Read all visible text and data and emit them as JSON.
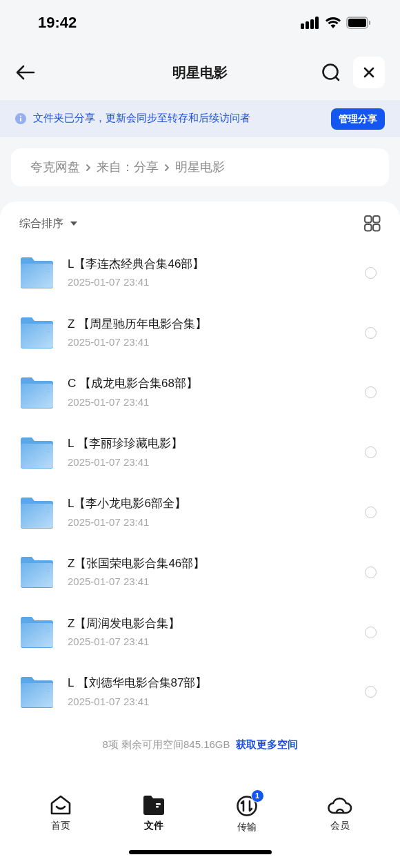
{
  "status_bar": {
    "time": "19:42"
  },
  "header": {
    "title": "明星电影"
  },
  "banner": {
    "text": "文件夹已分享，更新会同步至转存和后续访问者",
    "button": "管理分享"
  },
  "breadcrumb": [
    "夸克网盘",
    "来自：分享",
    "明星电影"
  ],
  "toolbar": {
    "sort": "综合排序"
  },
  "files": [
    {
      "name": "L【李连杰经典合集46部】",
      "date": "2025-01-07 23:41",
      "checked": false
    },
    {
      "name": "Z 【周星驰历年电影合集】",
      "date": "2025-01-07 23:41",
      "checked": false
    },
    {
      "name": "C 【成龙电影合集68部】",
      "date": "2025-01-07 23:41",
      "checked": false
    },
    {
      "name": "L 【李丽珍珍藏电影】",
      "date": "2025-01-07 23:41",
      "checked": false
    },
    {
      "name": "L【李小龙电影6部全】",
      "date": "2025-01-07 23:41",
      "checked": false
    },
    {
      "name": "Z【张国荣电影合集46部】",
      "date": "2025-01-07 23:41",
      "checked": false
    },
    {
      "name": "Z【周润发电影合集】",
      "date": "2025-01-07 23:41",
      "checked": false
    },
    {
      "name": "L 【刘德华电影合集87部】",
      "date": "2025-01-07 23:41",
      "checked": false
    }
  ],
  "footer": {
    "summary": "8项 剩余可用空间845.16GB",
    "link": "获取更多空间"
  },
  "tab_bar": [
    {
      "kind": "home",
      "label": "首页",
      "selected": false
    },
    {
      "kind": "files",
      "label": "文件",
      "selected": true
    },
    {
      "kind": "transfer",
      "label": "传输",
      "selected": false,
      "badge": "1"
    },
    {
      "kind": "member",
      "label": "会员",
      "selected": false
    }
  ]
}
